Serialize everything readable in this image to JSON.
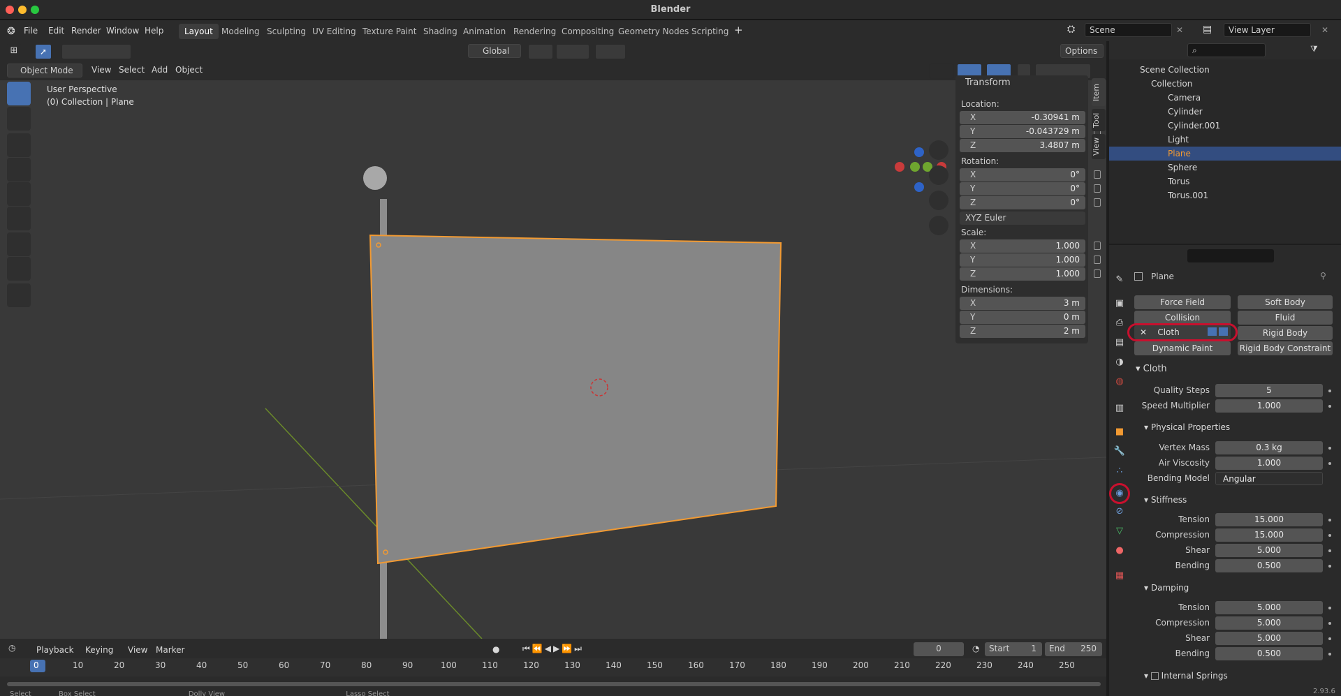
{
  "app": {
    "title": "Blender"
  },
  "menu": {
    "items": [
      "File",
      "Edit",
      "Render",
      "Window",
      "Help"
    ]
  },
  "workspaces": [
    "Layout",
    "Modeling",
    "Sculpting",
    "UV Editing",
    "Texture Paint",
    "Shading",
    "Animation",
    "Rendering",
    "Compositing",
    "Geometry Nodes",
    "Scripting"
  ],
  "scene": {
    "name": "Scene",
    "view_layer": "View Layer"
  },
  "header": {
    "transform_orientation": "Global",
    "options": "Options"
  },
  "viewport_header": {
    "mode": "Object Mode",
    "menus": [
      "View",
      "Select",
      "Add",
      "Object"
    ]
  },
  "viewport": {
    "perspective": "User Perspective",
    "collection_info": "(0) Collection | Plane"
  },
  "npanel": {
    "title": "Transform",
    "location_label": "Location:",
    "rotation_label": "Rotation:",
    "scale_label": "Scale:",
    "dimensions_label": "Dimensions:",
    "location": [
      {
        "axis": "X",
        "value": "-0.30941 m"
      },
      {
        "axis": "Y",
        "value": "-0.043729 m"
      },
      {
        "axis": "Z",
        "value": "3.4807 m"
      }
    ],
    "rotation": [
      {
        "axis": "X",
        "value": "0°"
      },
      {
        "axis": "Y",
        "value": "0°"
      },
      {
        "axis": "Z",
        "value": "0°"
      }
    ],
    "rotation_mode": "XYZ Euler",
    "scale": [
      {
        "axis": "X",
        "value": "1.000"
      },
      {
        "axis": "Y",
        "value": "1.000"
      },
      {
        "axis": "Z",
        "value": "1.000"
      }
    ],
    "dimensions": [
      {
        "axis": "X",
        "value": "3 m"
      },
      {
        "axis": "Y",
        "value": "0 m"
      },
      {
        "axis": "Z",
        "value": "2 m"
      }
    ],
    "tabs": [
      "Item",
      "Tool",
      "View"
    ]
  },
  "timeline": {
    "menus": [
      "Playback",
      "Keying",
      "View",
      "Marker"
    ],
    "current_frame": "0",
    "start_label": "Start",
    "start": "1",
    "end_label": "End",
    "end": "250",
    "ticks": [
      "0",
      "10",
      "20",
      "30",
      "40",
      "50",
      "60",
      "70",
      "80",
      "90",
      "100",
      "110",
      "120",
      "130",
      "140",
      "150",
      "160",
      "170",
      "180",
      "190",
      "200",
      "210",
      "220",
      "230",
      "240",
      "250"
    ]
  },
  "statusbar": {
    "items": [
      "Select",
      "Box Select",
      "Dolly View",
      "Lasso Select"
    ],
    "version": "2.93.6"
  },
  "outliner": {
    "root": "Scene Collection",
    "collection": "Collection",
    "objects": [
      "Camera",
      "Cylinder",
      "Cylinder.001",
      "Light",
      "Plane",
      "Sphere",
      "Torus",
      "Torus.001"
    ]
  },
  "properties": {
    "object_name": "Plane",
    "physics_buttons": {
      "force_field": "Force Field",
      "soft_body": "Soft Body",
      "collision": "Collision",
      "fluid": "Fluid",
      "cloth": "Cloth",
      "rigid_body": "Rigid Body",
      "dynamic_paint": "Dynamic Paint",
      "rigid_body_constraint": "Rigid Body Constraint"
    },
    "cloth_panel": "Cloth",
    "quality_steps_label": "Quality Steps",
    "quality_steps": "5",
    "speed_multiplier_label": "Speed Multiplier",
    "speed_multiplier": "1.000",
    "physical_properties": "Physical Properties",
    "vertex_mass_label": "Vertex Mass",
    "vertex_mass": "0.3 kg",
    "air_viscosity_label": "Air Viscosity",
    "air_viscosity": "1.000",
    "bending_model_label": "Bending Model",
    "bending_model": "Angular",
    "stiffness": "Stiffness",
    "stiffness_rows": [
      {
        "label": "Tension",
        "value": "15.000"
      },
      {
        "label": "Compression",
        "value": "15.000"
      },
      {
        "label": "Shear",
        "value": "5.000"
      },
      {
        "label": "Bending",
        "value": "0.500"
      }
    ],
    "damping": "Damping",
    "damping_rows": [
      {
        "label": "Tension",
        "value": "5.000"
      },
      {
        "label": "Compression",
        "value": "5.000"
      },
      {
        "label": "Shear",
        "value": "5.000"
      },
      {
        "label": "Bending",
        "value": "0.500"
      }
    ],
    "internal_springs": "Internal Springs"
  },
  "colors": {
    "accent": "#4772b3",
    "selection": "#f29a32",
    "highlight": "#c8102e"
  }
}
